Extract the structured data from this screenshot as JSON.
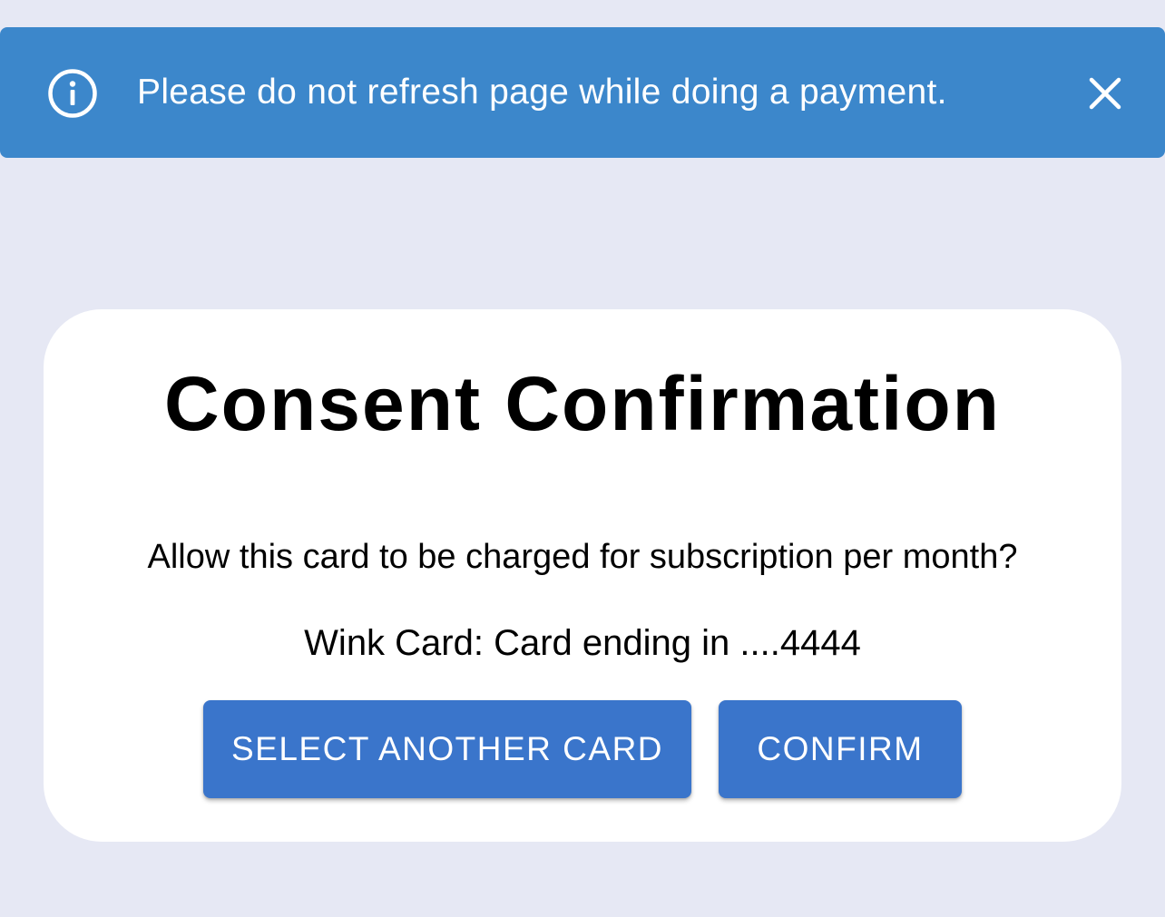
{
  "alert": {
    "icon": "info-circle-icon",
    "message": "Please do not refresh page while doing a payment.",
    "close_icon": "close-icon",
    "background": "#3c87cb"
  },
  "dialog": {
    "title": "Consent Confirmation",
    "question": "Allow this card to be charged for subscription per month?",
    "card_info": "Wink Card: Card ending in ....4444",
    "buttons": {
      "select_another_label": "SELECT ANOTHER CARD",
      "confirm_label": "CONFIRM"
    },
    "button_color": "#3a75cb"
  },
  "page": {
    "background": "#e6e8f4"
  }
}
